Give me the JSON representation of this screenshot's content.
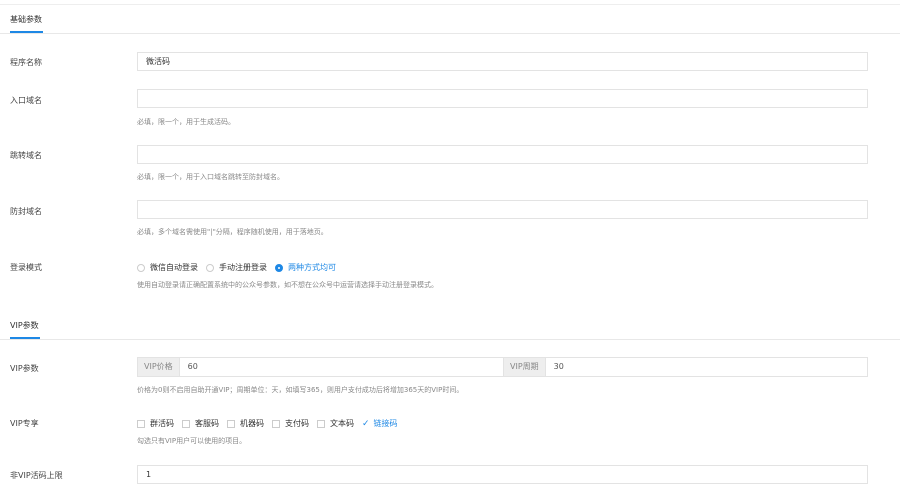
{
  "sections": {
    "basic": {
      "title": "基础参数"
    },
    "vip": {
      "title": "VIP参数"
    }
  },
  "fields": {
    "program_name": {
      "label": "程序名称",
      "value": "微活码"
    },
    "entry_domain": {
      "label": "入口域名",
      "value": "",
      "help": "必填，限一个，用于生成活码。"
    },
    "jump_domain": {
      "label": "跳转域名",
      "value": "",
      "help": "必填，限一个，用于入口域名跳转至防封域名。"
    },
    "block_domain": {
      "label": "防封域名",
      "value": "",
      "help": "必填，多个域名需使用\"|\"分隔，程序随机使用，用于落地页。"
    },
    "login_mode": {
      "label": "登录模式",
      "options": [
        "微信自动登录",
        "手动注册登录",
        "两种方式均可"
      ],
      "selected": "两种方式均可",
      "help": "使用自动登录请正确配置系统中的公众号参数，如不想在公众号中运营请选择手动注册登录模式。"
    },
    "vip_params": {
      "label": "VIP参数",
      "price_label": "VIP价格",
      "price": "60",
      "period_label": "VIP周期",
      "period": "30",
      "help": "价格为0则不启用自助开通VIP；周期单位：天，如填写365，则用户支付成功后将增加365天的VIP时间。"
    },
    "vip_exclusive": {
      "label": "VIP专享",
      "options": [
        "群活码",
        "客服码",
        "机器码",
        "支付码",
        "文本码",
        "链接码"
      ],
      "checked": "链接码",
      "help": "勾选只有VIP用户可以使用的项目。"
    },
    "non_vip_limit": {
      "label": "非VIP活码上限",
      "value": "1"
    }
  },
  "colors": {
    "accent": "#1e88e5"
  }
}
